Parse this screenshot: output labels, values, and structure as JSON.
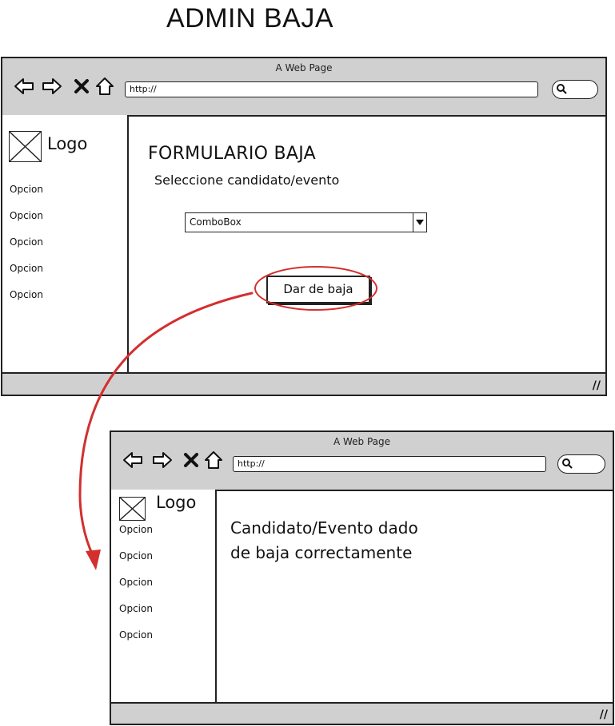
{
  "page": {
    "title": "ADMIN BAJA"
  },
  "browser1": {
    "window_title": "A Web Page",
    "url": "http://",
    "sidebar": {
      "logo_label": "Logo",
      "items": [
        "Opcion",
        "Opcion",
        "Opcion",
        "Opcion",
        "Opcion"
      ]
    },
    "form": {
      "title": "FORMULARIO BAJA",
      "subtitle": "Seleccione candidato/evento",
      "combo_value": "ComboBox",
      "button_label": "Dar de baja"
    }
  },
  "browser2": {
    "window_title": "A Web Page",
    "url": "http://",
    "sidebar": {
      "logo_label": "Logo",
      "items": [
        "Opcion",
        "Opcion",
        "Opcion",
        "Opcion",
        "Opcion"
      ]
    },
    "message_line1": "Candidato/Evento dado",
    "message_line2": "de baja correctamente"
  },
  "colors": {
    "annotation": "#d32f2f",
    "chrome": "#d0d0d0"
  },
  "icons": [
    "back-arrow-icon",
    "forward-arrow-icon",
    "stop-icon",
    "home-icon",
    "search-icon",
    "image-placeholder-icon",
    "resize-grip-icon",
    "dropdown-arrow-icon"
  ]
}
